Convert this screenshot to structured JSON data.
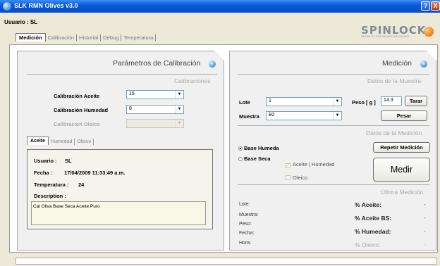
{
  "window": {
    "title": "SLK RMN Olives v3.0",
    "help": "?",
    "close": "X"
  },
  "header": {
    "user_line": "Usuario : SL",
    "logo_word": "SPINLOCK",
    "logo_sub": "MAGNETIC RESONANCE SOLUTIONS"
  },
  "main_tabs": [
    "Medición",
    "Calibración",
    "Historial",
    "Debug",
    "Temperatura"
  ],
  "left": {
    "title": "Parámetros de Calibración",
    "section": "Calibraciones",
    "cal_aceite_label": "Calibración Aceite",
    "cal_aceite_value": "15",
    "cal_humedad_label": "Calibración Humedad",
    "cal_humedad_value": "8",
    "cal_oleico_label": "Calibración Oleico",
    "cal_oleico_value": "",
    "subtabs": [
      "Aceite",
      "Humedad",
      "Oleico"
    ],
    "info": {
      "usuario_label": "Usuario :",
      "usuario_value": "SL",
      "fecha_label": "Fecha :",
      "fecha_value": "17/04/2009 11:33:49 a.m.",
      "temp_label": "Temperatura :",
      "temp_value": "24",
      "desc_label": "Description :",
      "desc_value": "Cal Oliva Base Seca Aceite Puro"
    }
  },
  "right": {
    "title": "Medición",
    "section_muestra": "Datos de la Muestra",
    "lote_label": "Lote",
    "lote_value": "1",
    "muestra_label": "Muestra",
    "muestra_value": "B2",
    "peso_label": "Peso [ g ]",
    "peso_value": "14.3",
    "tarar": "Tarar",
    "pesar": "Pesar",
    "section_medicion": "Datos de la Medición",
    "radio_humeda": "Base Humeda",
    "radio_seca": "Base Seca",
    "repetir": "Repetir Medición",
    "chk_aceite": "Aceite | Humedad",
    "chk_oleico": "Oleico",
    "medir": "Medir",
    "section_ultima": "Última Medición",
    "res_labels": [
      "Lote:",
      "Muestra:",
      "Peso:",
      "Fecha:",
      "Hora:"
    ],
    "res_keys": [
      "% Aceite:",
      "% Aceite BS:",
      "% Humedad:",
      "% Oleico:"
    ],
    "res_vals": [
      "-",
      "-",
      "-",
      "-"
    ]
  }
}
